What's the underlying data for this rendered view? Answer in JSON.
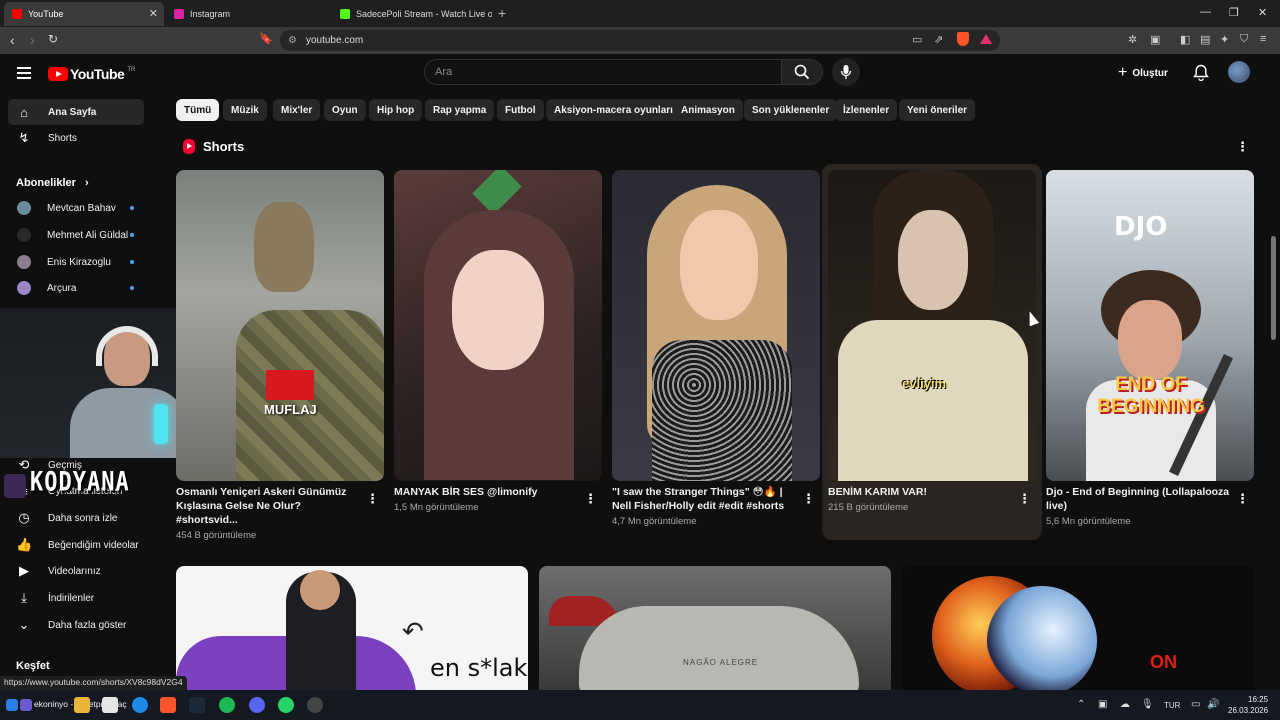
{
  "browser": {
    "tabs": [
      {
        "label": "YouTube",
        "active": true,
        "color": "#ff0000"
      },
      {
        "label": "Instagram",
        "active": false,
        "color": "#d6249f"
      },
      {
        "label": "SadecePoli Stream - Watch Live o",
        "active": false,
        "color": "#53fc18"
      }
    ],
    "url": "youtube.com",
    "status_url": "https://www.youtube.com/shorts/XV8c98dV2G4"
  },
  "masthead": {
    "logo_text": "YouTube",
    "country": "TR",
    "search_placeholder": "Ara",
    "create_label": "Oluştur"
  },
  "sidebar": {
    "main": [
      {
        "label": "Ana Sayfa",
        "icon": "home-icon",
        "active": true
      },
      {
        "label": "Shorts",
        "icon": "shorts-icon",
        "active": false
      }
    ],
    "subscriptions_title": "Abonelikler",
    "subscriptions": [
      {
        "label": "Mevtcan Bahav",
        "live": true
      },
      {
        "label": "Mehmet Ali Güldal",
        "live": true
      },
      {
        "label": "Enis Kirazoglu",
        "live": true
      },
      {
        "label": "Arçura",
        "live": true
      }
    ],
    "you": [
      {
        "label": "Geçmiş",
        "icon": "history-icon"
      },
      {
        "label": "Oynatma listeleri",
        "icon": "playlist-icon"
      },
      {
        "label": "Daha sonra izle",
        "icon": "watch-later-icon"
      },
      {
        "label": "Beğendiğim videolar",
        "icon": "like-icon"
      },
      {
        "label": "Videolarınız",
        "icon": "your-videos-icon"
      },
      {
        "label": "İndirilenler",
        "icon": "download-icon"
      },
      {
        "label": "Daha fazla göster",
        "icon": "chevron-down-icon"
      }
    ],
    "explore_title": "Keşfet"
  },
  "overlay": {
    "watermark": "KODYANA"
  },
  "chips": [
    "Tümü",
    "Müzik",
    "Mix'ler",
    "Oyun",
    "Hip hop",
    "Rap yapma",
    "Futbol",
    "Aksiyon-macera oyunları",
    "Animasyon",
    "Son yüklenenler",
    "İzlenenler",
    "Yeni öneriler"
  ],
  "shorts": {
    "title": "Shorts",
    "items": [
      {
        "title": "Osmanlı Yeniçeri Askeri Günümüz Kışlasına Gelse Ne Olur? #shortsvid...",
        "views": "454 B görüntüleme",
        "caption": "MUFLAJ"
      },
      {
        "title": "MANYAK BİR SES @limonify",
        "views": "1,5 Mn görüntüleme",
        "caption": ""
      },
      {
        "title": "\"I saw the Stranger Things\" 😳🔥 | Nell Fisher/Holly edit #edit #shorts",
        "views": "4,7 Mn görüntüleme",
        "caption": ""
      },
      {
        "title": "BENİM KARIM VAR!",
        "views": "215 B görüntüleme",
        "caption": "evliyim"
      },
      {
        "title": "Djo - End of Beginning (Lollapalooza live)",
        "views": "5,6 Mn görüntüleme",
        "caption": "DJO",
        "caption2": "END OF BEGINNING"
      }
    ]
  },
  "videos": [
    {
      "overlay_text": "en s*lak"
    },
    {
      "overlay_text": "NAGÃO ALEGRE"
    },
    {
      "overlay_text": "ON"
    }
  ],
  "taskbar": {
    "now_playing": "ekoninyo - bulletproof aç",
    "language": "TUR",
    "time": "16:25",
    "date": "26.03.2026"
  }
}
